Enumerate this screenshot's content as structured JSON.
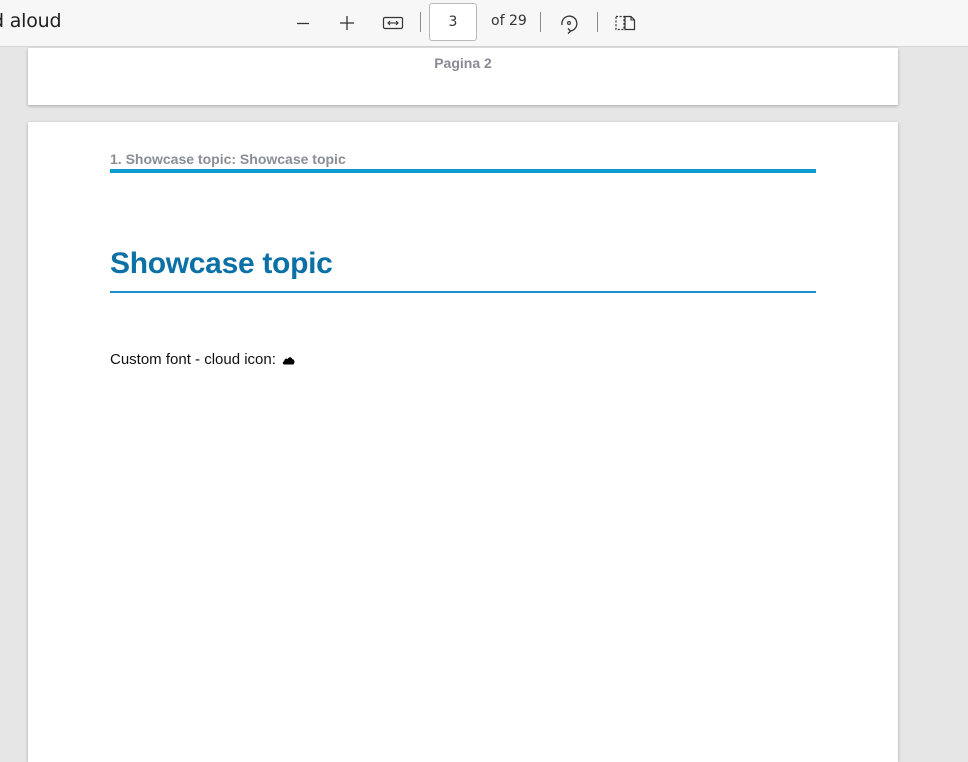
{
  "toolbar": {
    "read_aloud_label": "d aloud",
    "current_page": "3",
    "page_of": "of 29"
  },
  "document": {
    "prev_page_footer": "Pagina 2",
    "running_header": "1. Showcase topic: Showcase topic",
    "topic_title": "Showcase topic",
    "body_text": "Custom font - cloud icon:",
    "accent_color": "#0b70a6",
    "rule_color": "#0d9bd1"
  },
  "icons": [
    "minus-icon",
    "plus-icon",
    "fit-width-icon",
    "rotate-icon",
    "two-page-view-icon",
    "cloud-icon"
  ]
}
